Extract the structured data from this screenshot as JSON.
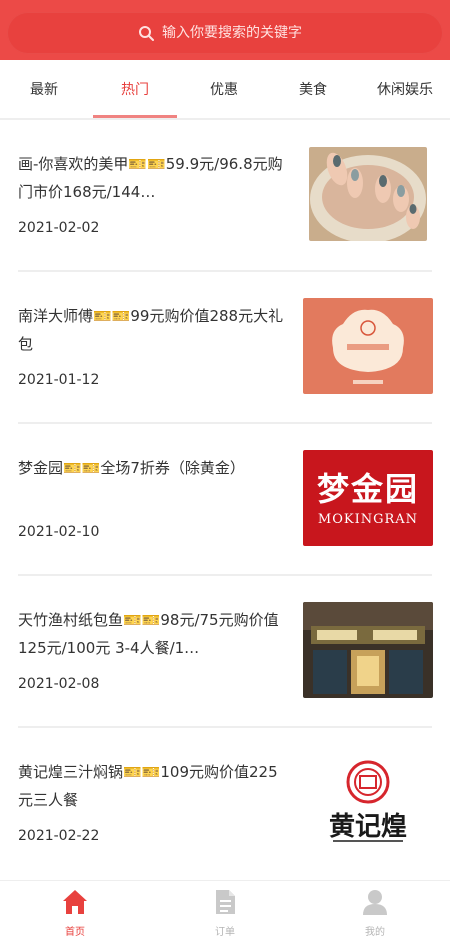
{
  "search": {
    "placeholder": "输入你要搜索的关键字"
  },
  "tabs": [
    {
      "label": "最新"
    },
    {
      "label": "热门"
    },
    {
      "label": "优惠"
    },
    {
      "label": "美食"
    },
    {
      "label": "休闲娱乐"
    }
  ],
  "items": [
    {
      "title": "画-你喜欢的美甲🎫🎫59.9元/96.8元购门市价168元/144…",
      "date": "2021-02-02",
      "image": "nail-art-photo"
    },
    {
      "title": "南洋大师傅🎫🎫99元购价值288元大礼包",
      "date": "2021-01-12",
      "image": "nanyang-logo"
    },
    {
      "title": "梦金园🎫🎫全场7折券（除黄金）",
      "date": "2021-02-10",
      "image": "mokingran-logo",
      "logo_cn": "梦金园",
      "logo_en": "MOKINGRAN"
    },
    {
      "title": "天竹渔村纸包鱼🎫🎫98元/75元购价值125元/100元 3-4人餐/1…",
      "date": "2021-02-08",
      "image": "restaurant-storefront-photo"
    },
    {
      "title": "黄记煌三汁焖锅🎫🎫109元购价值225元三人餐",
      "date": "2021-02-22",
      "image": "huangjihuang-logo",
      "logo_cn": "黄记煌"
    }
  ],
  "tabbar": [
    {
      "label": "首页",
      "icon": "home-icon"
    },
    {
      "label": "订单",
      "icon": "order-document-icon"
    },
    {
      "label": "我的",
      "icon": "user-icon"
    }
  ],
  "colors": {
    "accent": "#e8413e",
    "header": "#ec4a47",
    "inactive": "#b5b5b5"
  }
}
